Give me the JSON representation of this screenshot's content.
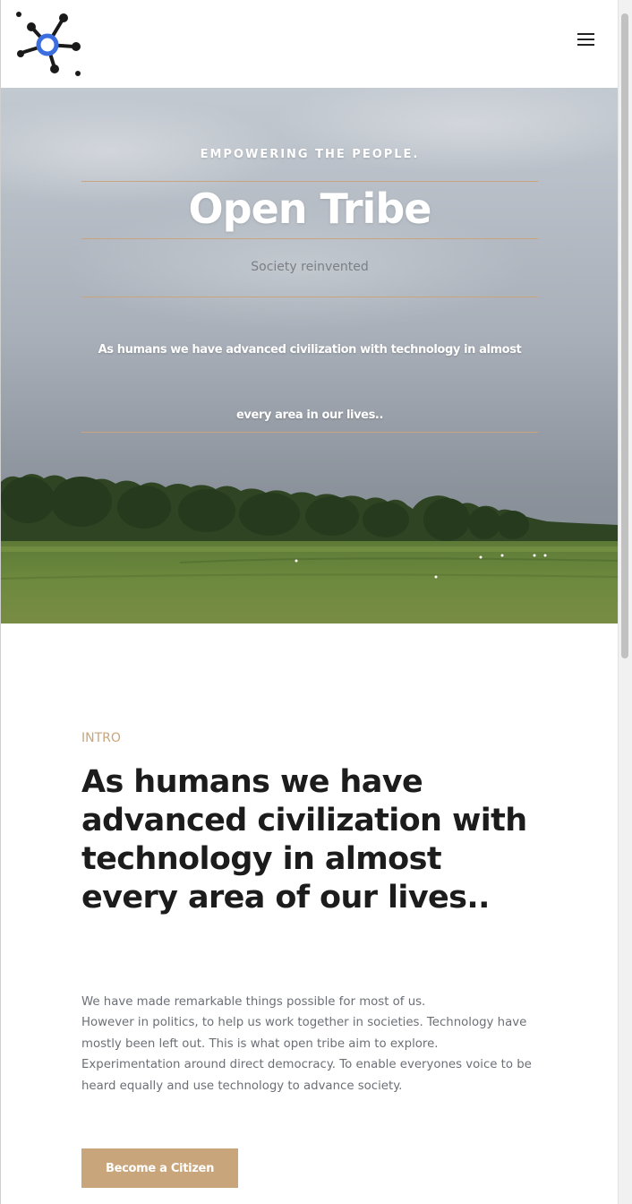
{
  "header": {
    "logo_icon": "network-nodes-logo-icon",
    "menu_icon": "hamburger-menu-icon"
  },
  "hero": {
    "eyebrow": "EMPOWERING THE PEOPLE.",
    "title": "Open Tribe",
    "subtitle": "Society reinvented",
    "lead": "As humans we have advanced civilization with technology in almost every area in our lives..",
    "accent_color": "#c8a57f"
  },
  "intro": {
    "label": "INTRO",
    "heading": "As humans we have advanced civilization with technology in almost every area of our lives..",
    "paragraphs": [
      "We have made remarkable things possible for most of us.",
      "However in politics, to help us work together in societies. Technology have mostly been left out. This is what open tribe aim to explore.",
      "Experimentation around direct democracy. To enable everyones voice to be heard equally and use technology to advance society."
    ],
    "cta_label": "Become a Citizen",
    "accent_color": "#c9a57b"
  }
}
